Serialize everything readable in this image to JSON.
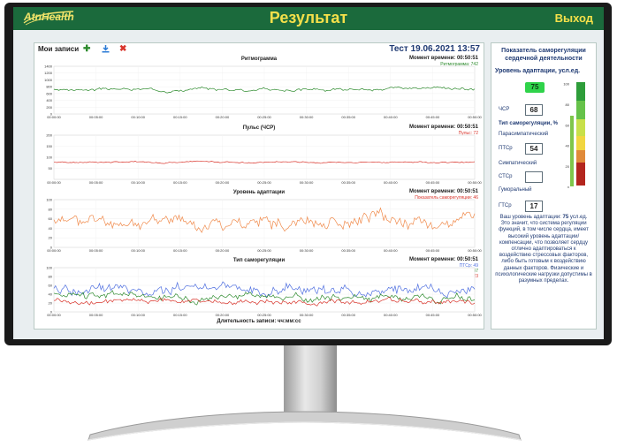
{
  "app": {
    "logo": "AtnHealth",
    "title": "Результат",
    "exit_label": "Выход"
  },
  "toolbar": {
    "records_label": "Мои записи",
    "add_icon": "plus-icon",
    "download_icon": "download-icon",
    "delete_icon": "close-icon"
  },
  "test_title": "Тест 19.06.2021 13:57",
  "x_axis_title": "Длительность записи: чч:мм:сс",
  "x_ticks": [
    "00:00:00",
    "00:05:00",
    "00:10:00",
    "00:15:00",
    "00:20:00",
    "00:25:00",
    "00:30:00",
    "00:35:00",
    "00:40:00",
    "00:45:00",
    "00:50:00"
  ],
  "colors": {
    "topbar": "#1b6a3c",
    "accent": "#f4e04a",
    "green": "#2e8b2e",
    "red": "#d9342b",
    "orange": "#f08a4b",
    "blue": "#4f6fe0"
  },
  "chart_data": [
    {
      "type": "line",
      "title": "Ритмограмма",
      "moment": "Момент времени: 00:50:51",
      "legend": [
        {
          "name": "Ритмограмма: 742",
          "color": "#2e8b2e"
        }
      ],
      "ylim": [
        0,
        1400
      ],
      "y_ticks": [
        "1400",
        "1200",
        "1000",
        "800",
        "600",
        "400",
        "200",
        "0"
      ],
      "series": [
        {
          "name": "Ритмограмма",
          "color": "#2e8b2e",
          "mean": 720,
          "amp": 80,
          "seed": 3
        }
      ]
    },
    {
      "type": "line",
      "title": "Пульс (ЧСР)",
      "moment": "Момент времени: 00:50:51",
      "legend": [
        {
          "name": "Пульс: 72",
          "color": "#d9342b"
        }
      ],
      "ylim": [
        0,
        200
      ],
      "y_ticks": [
        "200",
        "150",
        "100",
        "50"
      ],
      "series": [
        {
          "name": "Пульс",
          "color": "#d9342b",
          "mean": 78,
          "amp": 6,
          "seed": 7
        }
      ]
    },
    {
      "type": "line",
      "title": "Уровень адаптации",
      "moment": "Момент времени: 00:50:51",
      "legend": [
        {
          "name": "Показатель саморегуляции: 46",
          "color": "#d9342b"
        }
      ],
      "ylim": [
        0,
        100
      ],
      "y_ticks": [
        "100",
        "80",
        "60",
        "40",
        "20",
        "0"
      ],
      "series": [
        {
          "name": "Показатель саморегуляции",
          "color": "#f08a4b",
          "mean": 55,
          "amp": 28,
          "seed": 11
        }
      ]
    },
    {
      "type": "line",
      "title": "Тип саморегуляции",
      "moment": "Момент времени: 00:50:51",
      "legend": [
        {
          "name": "ПТСр: 49",
          "color": "#4f6fe0"
        },
        {
          "name": "СТСр: 37",
          "color": "#2e8b2e"
        },
        {
          "name": "ГТСр: 23",
          "color": "#d9342b"
        }
      ],
      "ylim": [
        0,
        100
      ],
      "y_ticks": [
        "100",
        "80",
        "60",
        "40",
        "20",
        "0"
      ],
      "series": [
        {
          "name": "ПТСр",
          "color": "#4f6fe0",
          "mean": 50,
          "amp": 25,
          "seed": 19
        },
        {
          "name": "СТСр",
          "color": "#2e8b2e",
          "mean": 35,
          "amp": 18,
          "seed": 23
        },
        {
          "name": "ГТСр",
          "color": "#d9342b",
          "mean": 22,
          "amp": 12,
          "seed": 29
        }
      ]
    }
  ],
  "right_panel": {
    "title": "Показатель саморегуляции сердечной деятельности",
    "level_label": "Уровень адаптации, усл.ед.",
    "level_value": "75",
    "hr_label": "ЧСР",
    "hr_value": "68",
    "type_label": "Тип саморегуляции, %",
    "para_label": "Парасимпатический",
    "ptsr_label": "ПТСр",
    "ptsr_value": "54",
    "symp_label": "Симпатический",
    "stsr_label": "СТСр",
    "stsr_value": "",
    "humoral_label": "Гуморальный",
    "gtsr_label": "ГТСр",
    "gtsr_value": "17",
    "scale_ticks": [
      "100",
      "80",
      "60",
      "40",
      "20",
      "0"
    ],
    "level_fraction": 0.75,
    "description_bold": "75",
    "description_start": "Ваш уровень адаптации:",
    "description_rest": "усл.ед. Это значит, что система регуляции функций, в том числе сердца, имеет высокий уровень адаптации/компенсации, что позволяет сердцу отлично адаптироваться к воздействию стрессовых факторов, либо быть готовым к воздействию данных факторов. Физические и психологические нагрузки допустимы в разумных пределах."
  }
}
